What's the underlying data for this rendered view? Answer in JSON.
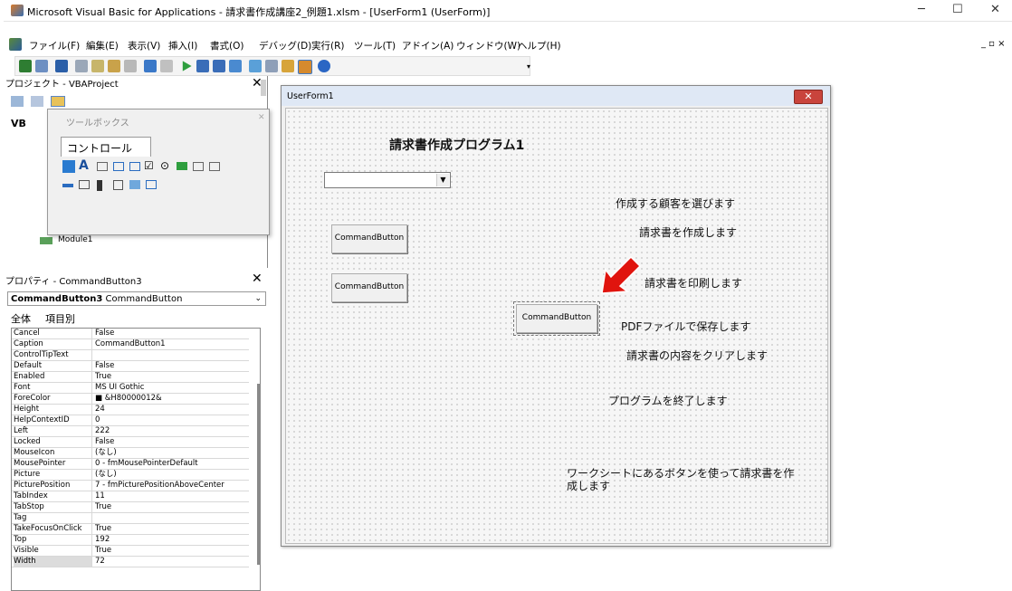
{
  "window": {
    "title": "Microsoft Visual Basic for Applications - 請求書作成講座2_例題1.xlsm - [UserForm1 (UserForm)]",
    "minimize": "─",
    "maximize": "☐",
    "close": "✕",
    "inner_controls": "_ ▫ ×"
  },
  "menu": [
    "ファイル(F)",
    "編集(E)",
    "表示(V)",
    "挿入(I)",
    "書式(O)",
    "デバッグ(D)",
    "実行(R)",
    "ツール(T)",
    "アドイン(A)",
    "ウィンドウ(W)",
    "ヘルプ(H)"
  ],
  "project_pane": {
    "title": "プロジェクト - VBAProject",
    "root": "VB",
    "module": "Module1"
  },
  "toolbox": {
    "title": "ツールボックス",
    "tab": "コントロール"
  },
  "properties_pane": {
    "title": "プロパティ - CommandButton3",
    "object_name": "CommandButton3",
    "object_type": "CommandButton",
    "tab_all": "全体",
    "tab_category": "項目別",
    "rows": [
      {
        "name": "Cancel",
        "value": "False"
      },
      {
        "name": "Caption",
        "value": "CommandButton1"
      },
      {
        "name": "ControlTipText",
        "value": ""
      },
      {
        "name": "Default",
        "value": "False"
      },
      {
        "name": "Enabled",
        "value": "True"
      },
      {
        "name": "Font",
        "value": "MS UI Gothic"
      },
      {
        "name": "ForeColor",
        "value": "■ &H80000012&"
      },
      {
        "name": "Height",
        "value": "24"
      },
      {
        "name": "HelpContextID",
        "value": "0"
      },
      {
        "name": "Left",
        "value": "222"
      },
      {
        "name": "Locked",
        "value": "False"
      },
      {
        "name": "MouseIcon",
        "value": "(なし)"
      },
      {
        "name": "MousePointer",
        "value": "0 - fmMousePointerDefault"
      },
      {
        "name": "Picture",
        "value": "(なし)"
      },
      {
        "name": "PicturePosition",
        "value": "7 - fmPicturePositionAboveCenter"
      },
      {
        "name": "TabIndex",
        "value": "11"
      },
      {
        "name": "TabStop",
        "value": "True"
      },
      {
        "name": "Tag",
        "value": ""
      },
      {
        "name": "TakeFocusOnClick",
        "value": "True"
      },
      {
        "name": "Top",
        "value": "192"
      },
      {
        "name": "Visible",
        "value": "True"
      },
      {
        "name": "Width",
        "value": "72"
      }
    ]
  },
  "userform": {
    "caption": "UserForm1",
    "heading": "請求書作成プログラム1",
    "buttons": [
      "CommandButton",
      "CommandButton",
      "CommandButton"
    ],
    "labels": {
      "select_customer": "作成する顧客を選びます",
      "create_invoice": "請求書を作成します",
      "print_invoice": "請求書を印刷します",
      "save_pdf": "PDFファイルで保存します",
      "clear_invoice": "請求書の内容をクリアします",
      "exit_program": "プログラムを終了します",
      "note_line1": "ワークシートにあるボタンを使って請求書を作",
      "note_line2": "成します"
    }
  },
  "colors": {
    "arrow": "#e0140e",
    "form_close": "#c9443c"
  }
}
